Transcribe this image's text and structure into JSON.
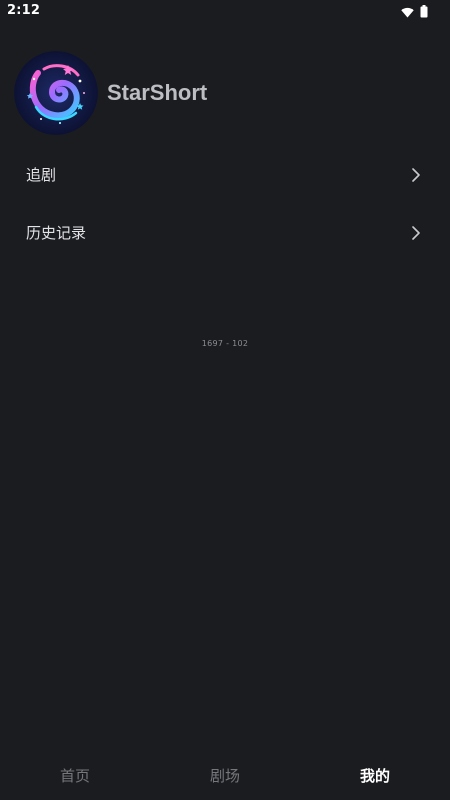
{
  "status_bar": {
    "time": "2:12",
    "icons": [
      "wifi-icon",
      "battery-icon"
    ]
  },
  "profile": {
    "name": "StarShort",
    "avatar": "galaxy-logo"
  },
  "menu": [
    {
      "label": "追剧",
      "icon": "chevron-right-icon"
    },
    {
      "label": "历史记录",
      "icon": "chevron-right-icon"
    }
  ],
  "version_text": "1697 - 102",
  "tabs": [
    {
      "label": "首页",
      "active": false
    },
    {
      "label": "剧场",
      "active": false
    },
    {
      "label": "我的",
      "active": true
    }
  ],
  "colors": {
    "background": "#1b1c20",
    "tab_inactive": "#76777c",
    "tab_active": "#ffffff"
  }
}
